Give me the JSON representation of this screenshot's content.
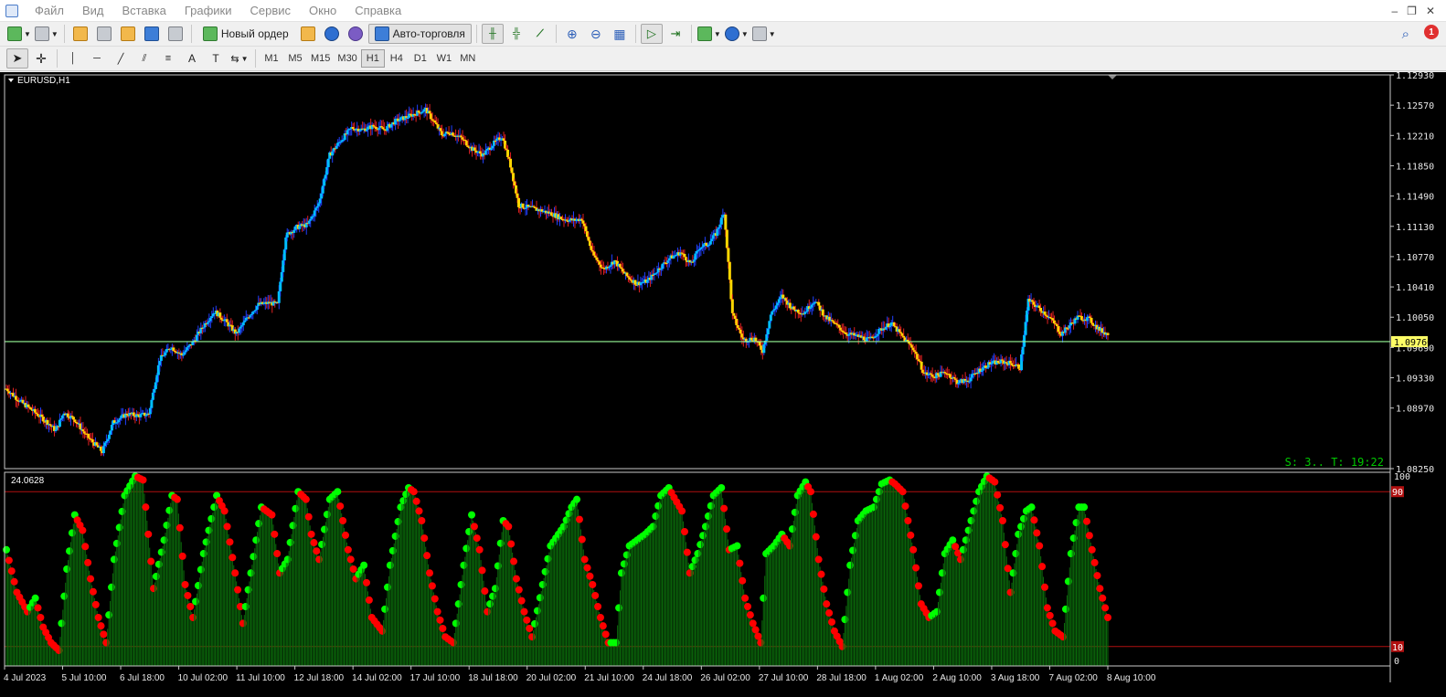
{
  "menu": {
    "items": [
      "Файл",
      "Вид",
      "Вставка",
      "Графики",
      "Сервис",
      "Окно",
      "Справка"
    ]
  },
  "toolbar": {
    "new_order_label": "Новый ордер",
    "auto_trading_label": "Авто-торговля",
    "notification_count": "1"
  },
  "timeframes": [
    "M1",
    "M5",
    "M15",
    "M30",
    "H1",
    "H4",
    "D1",
    "W1",
    "MN"
  ],
  "active_timeframe": "H1",
  "chart": {
    "symbol_label": "EURUSD,H1",
    "price_ticks": [
      "1.12930",
      "1.12570",
      "1.12210",
      "1.11850",
      "1.11490",
      "1.11130",
      "1.10770",
      "1.10410",
      "1.10050",
      "1.09690",
      "1.09330",
      "1.08970",
      "1.08250"
    ],
    "current_price_label": "1.09760",
    "current_price": 1.0976,
    "status_text": "S: 3.. T: 19:22",
    "colors": {
      "background": "#000000",
      "bull_candle": "#00bfff",
      "bear_candle": "#ffd700",
      "wick_up": "#2040ff",
      "wick_down": "#e02020",
      "price_line": "#98fb98",
      "indicator_up": "#00ff00",
      "indicator_down": "#ff0000",
      "histogram": "#0b6b0b"
    }
  },
  "indicator": {
    "value_label": "24.0628",
    "scale_top": "100",
    "scale_bottom": "0",
    "upper_level_label": "90",
    "lower_level_label": "10"
  },
  "time_axis": [
    "4 Jul 2023",
    "5 Jul 10:00",
    "6 Jul 18:00",
    "10 Jul 02:00",
    "11 Jul 10:00",
    "12 Jul 18:00",
    "14 Jul 02:00",
    "17 Jul 10:00",
    "18 Jul 18:00",
    "20 Jul 02:00",
    "21 Jul 10:00",
    "24 Jul 18:00",
    "26 Jul 02:00",
    "27 Jul 10:00",
    "28 Jul 18:00",
    "1 Aug 02:00",
    "2 Aug 10:00",
    "3 Aug 18:00",
    "7 Aug 02:00",
    "8 Aug 10:00"
  ],
  "chart_data": {
    "type": "candlestick",
    "symbol": "EURUSD",
    "timeframe": "H1",
    "y_range": [
      1.0825,
      1.1293
    ],
    "price_path": [
      [
        0,
        1.092
      ],
      [
        10,
        1.0905
      ],
      [
        20,
        1.0893
      ],
      [
        30,
        1.088
      ],
      [
        36,
        1.087
      ],
      [
        42,
        1.0892
      ],
      [
        50,
        1.0883
      ],
      [
        58,
        1.0865
      ],
      [
        64,
        1.0855
      ],
      [
        70,
        1.0845
      ],
      [
        78,
        1.088
      ],
      [
        88,
        1.089
      ],
      [
        96,
        1.0888
      ],
      [
        104,
        1.089
      ],
      [
        112,
        1.0955
      ],
      [
        120,
        1.097
      ],
      [
        128,
        1.096
      ],
      [
        136,
        1.0975
      ],
      [
        144,
        1.0995
      ],
      [
        152,
        1.1012
      ],
      [
        160,
        1.1
      ],
      [
        168,
        1.0985
      ],
      [
        176,
        1.1005
      ],
      [
        184,
        1.102
      ],
      [
        192,
        1.1022
      ],
      [
        198,
        1.102
      ],
      [
        204,
        1.1102
      ],
      [
        212,
        1.1112
      ],
      [
        220,
        1.1115
      ],
      [
        228,
        1.114
      ],
      [
        236,
        1.1198
      ],
      [
        244,
        1.1215
      ],
      [
        252,
        1.123
      ],
      [
        260,
        1.1228
      ],
      [
        268,
        1.1232
      ],
      [
        276,
        1.1228
      ],
      [
        284,
        1.1238
      ],
      [
        292,
        1.1243
      ],
      [
        300,
        1.1248
      ],
      [
        306,
        1.1252
      ],
      [
        312,
        1.1238
      ],
      [
        318,
        1.1222
      ],
      [
        324,
        1.1225
      ],
      [
        332,
        1.1218
      ],
      [
        340,
        1.1205
      ],
      [
        348,
        1.1198
      ],
      [
        356,
        1.1212
      ],
      [
        362,
        1.122
      ],
      [
        368,
        1.1185
      ],
      [
        374,
        1.1138
      ],
      [
        382,
        1.1135
      ],
      [
        390,
        1.1132
      ],
      [
        398,
        1.1128
      ],
      [
        406,
        1.1122
      ],
      [
        414,
        1.112
      ],
      [
        420,
        1.1122
      ],
      [
        428,
        1.108
      ],
      [
        436,
        1.1062
      ],
      [
        444,
        1.1072
      ],
      [
        452,
        1.1055
      ],
      [
        460,
        1.1045
      ],
      [
        468,
        1.1048
      ],
      [
        476,
        1.1062
      ],
      [
        484,
        1.1075
      ],
      [
        492,
        1.1082
      ],
      [
        500,
        1.1068
      ],
      [
        506,
        1.1088
      ],
      [
        512,
        1.1092
      ],
      [
        518,
        1.1104
      ],
      [
        524,
        1.113
      ],
      [
        530,
        1.1008
      ],
      [
        538,
        1.0978
      ],
      [
        546,
        1.098
      ],
      [
        552,
        1.0965
      ],
      [
        558,
        1.1008
      ],
      [
        566,
        1.103
      ],
      [
        574,
        1.1015
      ],
      [
        582,
        1.101
      ],
      [
        590,
        1.1025
      ],
      [
        598,
        1.1005
      ],
      [
        606,
        1.0995
      ],
      [
        614,
        1.0985
      ],
      [
        622,
        1.0982
      ],
      [
        630,
        1.0978
      ],
      [
        638,
        1.099
      ],
      [
        646,
        1.0998
      ],
      [
        654,
        1.0982
      ],
      [
        662,
        1.0968
      ],
      [
        670,
        1.0938
      ],
      [
        678,
        1.0935
      ],
      [
        686,
        1.094
      ],
      [
        694,
        1.0928
      ],
      [
        702,
        1.093
      ],
      [
        710,
        1.0942
      ],
      [
        718,
        1.095
      ],
      [
        726,
        1.0952
      ],
      [
        734,
        1.095
      ],
      [
        740,
        1.0945
      ],
      [
        746,
        1.1025
      ],
      [
        752,
        1.1018
      ],
      [
        758,
        1.101
      ],
      [
        764,
        1.1
      ],
      [
        770,
        1.0985
      ],
      [
        776,
        1.0995
      ],
      [
        782,
        1.1005
      ],
      [
        790,
        1.1003
      ],
      [
        798,
        1.099
      ],
      [
        804,
        1.0985
      ]
    ],
    "oscillator": {
      "upper_level": 90,
      "lower_level": 10,
      "y_range": [
        0,
        100
      ],
      "last_value": 24.0628,
      "path": [
        [
          0,
          60
        ],
        [
          8,
          38
        ],
        [
          16,
          28
        ],
        [
          22,
          35
        ],
        [
          28,
          20
        ],
        [
          34,
          12
        ],
        [
          40,
          8
        ],
        [
          46,
          50
        ],
        [
          52,
          78
        ],
        [
          58,
          70
        ],
        [
          64,
          45
        ],
        [
          70,
          25
        ],
        [
          76,
          12
        ],
        [
          82,
          55
        ],
        [
          90,
          88
        ],
        [
          98,
          98
        ],
        [
          104,
          96
        ],
        [
          112,
          40
        ],
        [
          120,
          65
        ],
        [
          126,
          88
        ],
        [
          130,
          86
        ],
        [
          136,
          42
        ],
        [
          142,
          25
        ],
        [
          150,
          58
        ],
        [
          160,
          88
        ],
        [
          166,
          80
        ],
        [
          174,
          48
        ],
        [
          180,
          22
        ],
        [
          186,
          48
        ],
        [
          194,
          82
        ],
        [
          202,
          78
        ],
        [
          208,
          48
        ],
        [
          214,
          55
        ],
        [
          222,
          90
        ],
        [
          228,
          86
        ],
        [
          232,
          68
        ],
        [
          238,
          55
        ],
        [
          246,
          86
        ],
        [
          252,
          90
        ],
        [
          260,
          60
        ],
        [
          266,
          45
        ],
        [
          272,
          52
        ],
        [
          278,
          25
        ],
        [
          286,
          18
        ],
        [
          292,
          52
        ],
        [
          300,
          82
        ],
        [
          306,
          92
        ],
        [
          310,
          90
        ],
        [
          316,
          75
        ],
        [
          322,
          48
        ],
        [
          328,
          28
        ],
        [
          334,
          15
        ],
        [
          340,
          12
        ],
        [
          348,
          52
        ],
        [
          354,
          78
        ],
        [
          360,
          60
        ],
        [
          366,
          28
        ],
        [
          372,
          40
        ],
        [
          378,
          75
        ],
        [
          382,
          72
        ],
        [
          388,
          45
        ],
        [
          394,
          28
        ],
        [
          400,
          15
        ],
        [
          408,
          42
        ],
        [
          414,
          62
        ],
        [
          420,
          68
        ],
        [
          424,
          72
        ],
        [
          430,
          82
        ],
        [
          434,
          86
        ],
        [
          440,
          55
        ],
        [
          446,
          42
        ],
        [
          452,
          25
        ],
        [
          458,
          12
        ],
        [
          464,
          12
        ],
        [
          468,
          48
        ],
        [
          474,
          62
        ],
        [
          480,
          65
        ],
        [
          486,
          68
        ],
        [
          492,
          72
        ],
        [
          498,
          88
        ],
        [
          504,
          92
        ],
        [
          508,
          87
        ],
        [
          514,
          80
        ],
        [
          520,
          48
        ],
        [
          526,
          58
        ],
        [
          532,
          72
        ],
        [
          538,
          88
        ],
        [
          544,
          92
        ],
        [
          550,
          60
        ],
        [
          556,
          62
        ],
        [
          562,
          35
        ],
        [
          568,
          22
        ],
        [
          574,
          12
        ],
        [
          578,
          58
        ],
        [
          584,
          62
        ],
        [
          590,
          68
        ],
        [
          596,
          62
        ],
        [
          602,
          88
        ],
        [
          608,
          95
        ],
        [
          612,
          90
        ],
        [
          618,
          55
        ],
        [
          624,
          32
        ],
        [
          630,
          18
        ],
        [
          636,
          10
        ],
        [
          642,
          52
        ],
        [
          648,
          75
        ],
        [
          654,
          80
        ],
        [
          660,
          82
        ],
        [
          666,
          94
        ],
        [
          672,
          96
        ],
        [
          676,
          94
        ],
        [
          682,
          90
        ],
        [
          690,
          60
        ],
        [
          696,
          32
        ],
        [
          702,
          25
        ],
        [
          708,
          28
        ],
        [
          714,
          58
        ],
        [
          720,
          65
        ],
        [
          726,
          55
        ],
        [
          734,
          75
        ],
        [
          740,
          90
        ],
        [
          746,
          98
        ],
        [
          752,
          95
        ],
        [
          758,
          75
        ],
        [
          764,
          38
        ],
        [
          770,
          68
        ],
        [
          776,
          80
        ],
        [
          780,
          82
        ],
        [
          786,
          62
        ],
        [
          792,
          30
        ],
        [
          798,
          18
        ],
        [
          804,
          15
        ],
        [
          810,
          58
        ],
        [
          816,
          82
        ],
        [
          820,
          82
        ],
        [
          826,
          60
        ],
        [
          832,
          40
        ],
        [
          838,
          25
        ]
      ]
    }
  }
}
